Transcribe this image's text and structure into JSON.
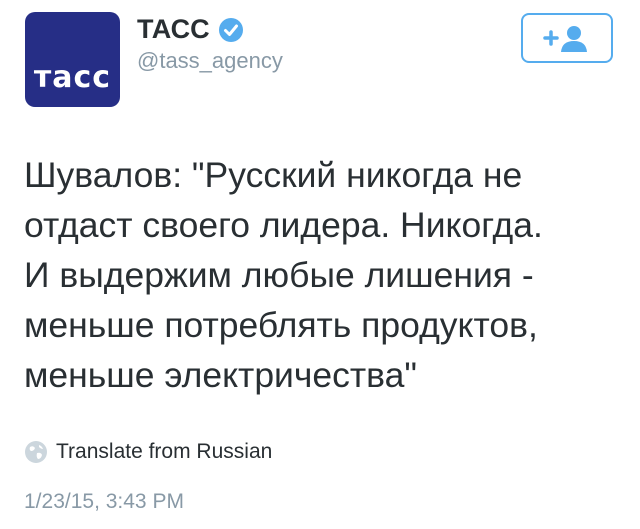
{
  "account": {
    "display_name": "ТАСС",
    "handle": "@tass_agency",
    "avatar_logo_text": "тасс",
    "verified": true
  },
  "colors": {
    "brand_blue": "#55acee",
    "avatar_bg": "#262e86",
    "text": "#292f33",
    "muted": "#8899a6"
  },
  "follow_button": {
    "icon": "add-user-icon"
  },
  "tweet": {
    "text": "Шувалов: \"Русский никогда не\nотдаст своего лидера. Никогда.\nИ выдержим любые лишения -\nменьше потреблять продуктов,\nменьше электричества\"",
    "translate_label": "Translate from Russian",
    "timestamp": "1/23/15, 3:43 PM"
  }
}
